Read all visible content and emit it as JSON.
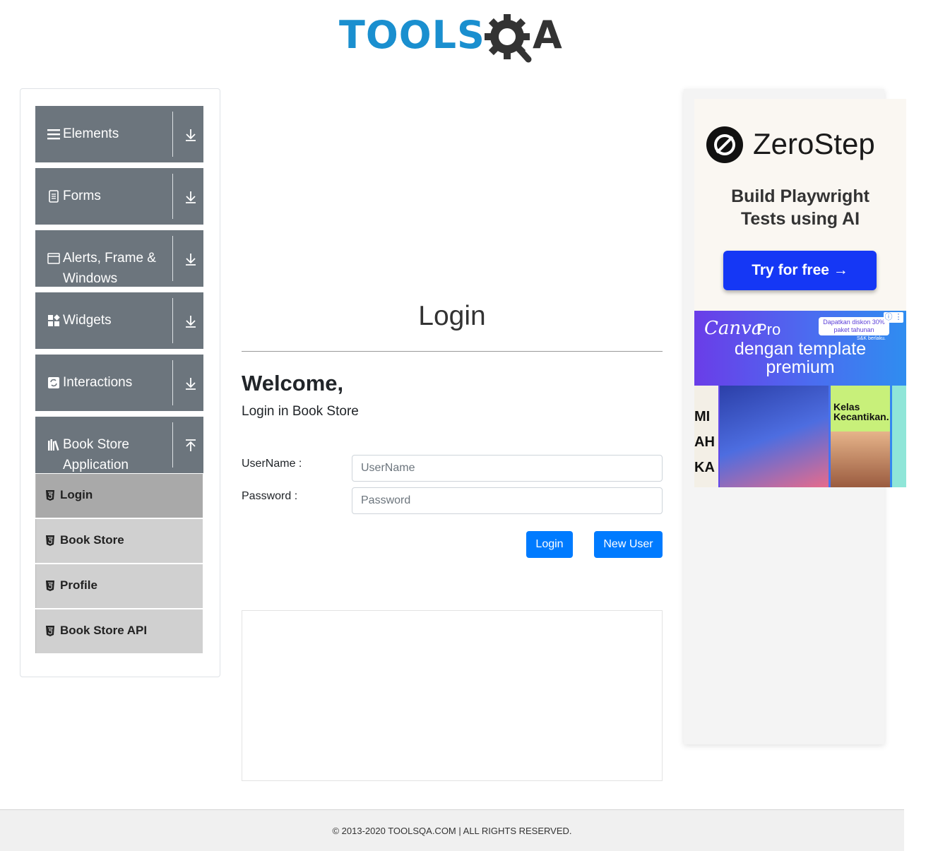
{
  "header": {
    "logo_text_left": "TOOLS",
    "logo_text_right": "A",
    "logo_color": "#1a8fcf",
    "logo_gear_color": "#333333"
  },
  "sidebar": {
    "groups": [
      {
        "label": "Elements",
        "icon": "hamburger-icon",
        "expanded": false
      },
      {
        "label": "Forms",
        "icon": "document-icon",
        "expanded": false
      },
      {
        "label": "Alerts, Frame &",
        "label2": "Windows",
        "icon": "window-icon",
        "expanded": false
      },
      {
        "label": "Widgets",
        "icon": "widgets-icon",
        "expanded": false
      },
      {
        "label": "Interactions",
        "icon": "interactions-icon",
        "expanded": false
      },
      {
        "label": "Book Store",
        "label2": "Application",
        "icon": "books-icon",
        "expanded": true
      }
    ],
    "book_store_items": [
      {
        "label": "Login",
        "active": true
      },
      {
        "label": "Book Store",
        "active": false
      },
      {
        "label": "Profile",
        "active": false
      },
      {
        "label": "Book Store API",
        "active": false
      }
    ]
  },
  "main": {
    "title": "Login",
    "welcome": "Welcome,",
    "subheading": "Login in Book Store",
    "username_label": "UserName :",
    "username_placeholder": "UserName",
    "username_value": "",
    "password_label": "Password :",
    "password_placeholder": "Password",
    "password_value": "",
    "login_button": "Login",
    "new_user_button": "New User"
  },
  "ads": {
    "zerostep": {
      "brand": "ZeroStep",
      "tagline_1": "Build Playwright",
      "tagline_2": "Tests using AI",
      "cta": "Try for free →"
    },
    "canva": {
      "brand": "Canva",
      "pro": "Pro",
      "line1": "dengan template",
      "line2": "premium",
      "promo_1": "Dapatkan diskon 30%",
      "promo_2": "paket tahunan",
      "terms": "S&K berlaku.",
      "info": "ⓘ ⋮",
      "tile_left_text": "MI AH KA",
      "tile_right_text_1": "Kelas",
      "tile_right_text_2": "Kecantikan."
    }
  },
  "footer": {
    "copyright": "© 2013-2020 TOOLSQA.COM | ALL RIGHTS RESERVED."
  },
  "colors": {
    "sidebar_group_bg": "#6c757d",
    "sub_item_bg": "#d0d0d0",
    "sub_item_active_bg": "#a9a9a9",
    "primary_button": "#007bff"
  }
}
